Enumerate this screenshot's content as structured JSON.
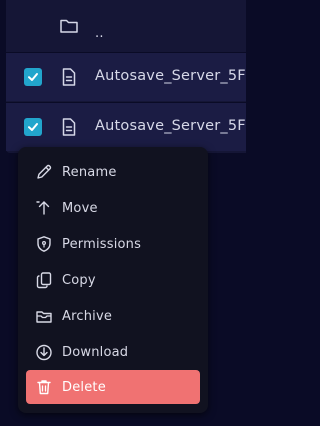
{
  "files": {
    "parent": {
      "name": ".."
    },
    "items": [
      {
        "name": "Autosave_Server_5F",
        "checked": true
      },
      {
        "name": "Autosave_Server_5F",
        "checked": true
      }
    ]
  },
  "context_menu": {
    "items": [
      {
        "label": "Rename",
        "icon": "pencil-icon"
      },
      {
        "label": "Move",
        "icon": "arrow-up-icon"
      },
      {
        "label": "Permissions",
        "icon": "shield-icon"
      },
      {
        "label": "Copy",
        "icon": "copy-icon"
      },
      {
        "label": "Archive",
        "icon": "archive-icon"
      },
      {
        "label": "Download",
        "icon": "download-icon"
      },
      {
        "label": "Delete",
        "icon": "trash-icon",
        "danger_color": "#f07272"
      }
    ]
  },
  "colors": {
    "background": "#0a0b26",
    "checkbox": "#22a5cc",
    "danger": "#f07272"
  }
}
